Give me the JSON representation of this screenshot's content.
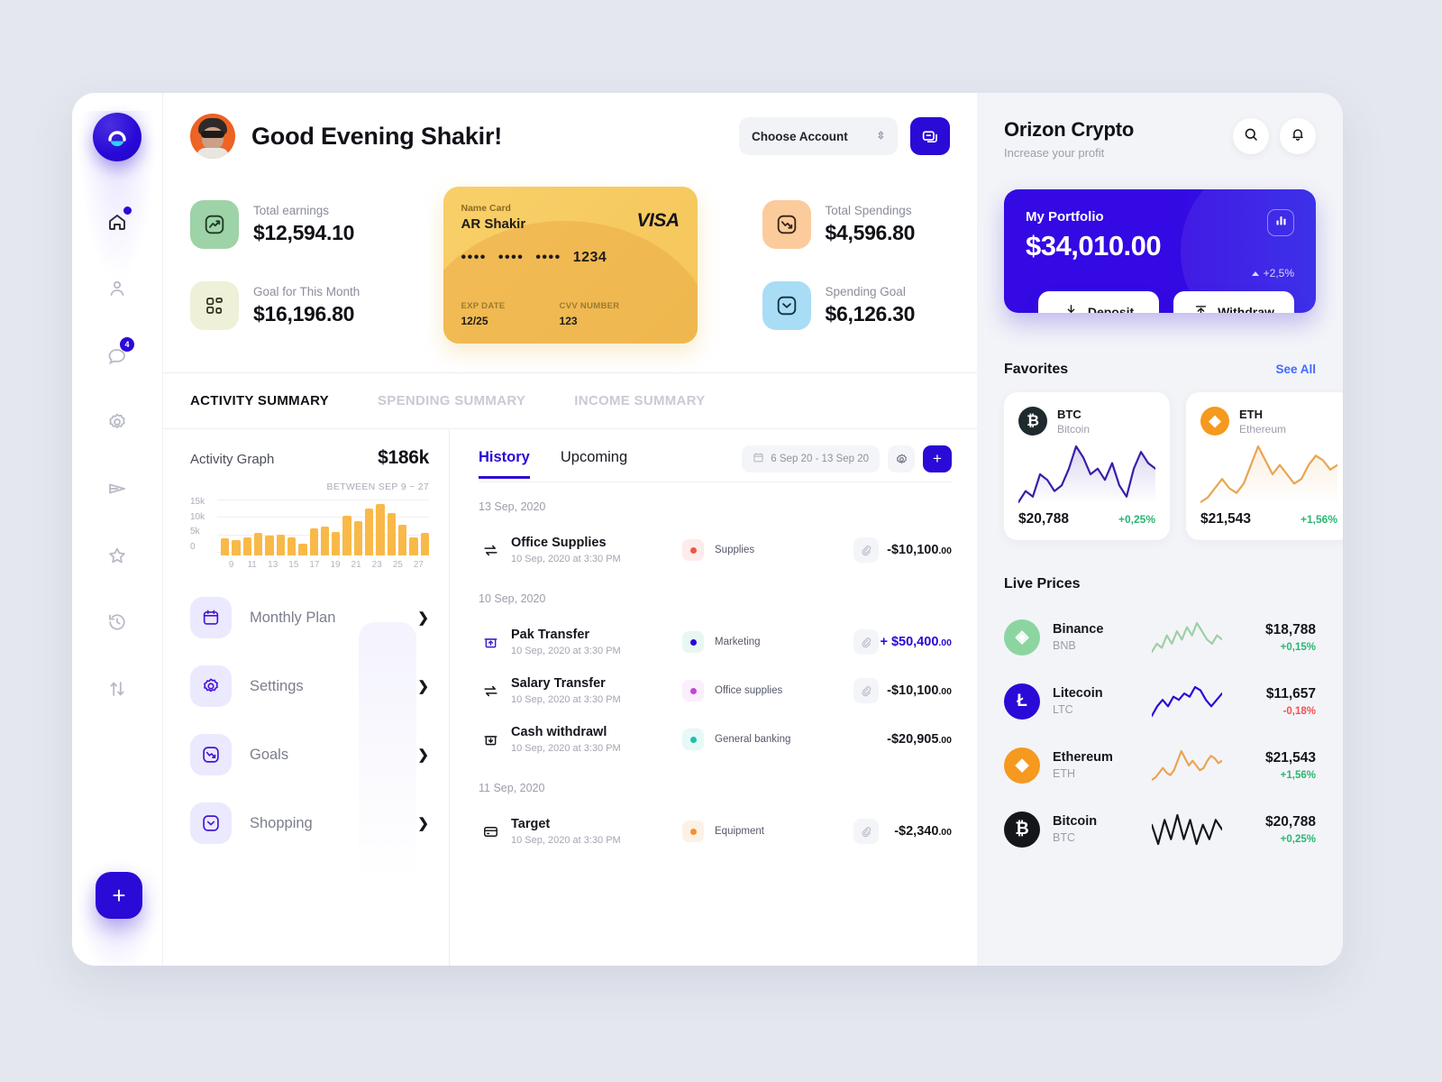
{
  "rail": {
    "logo_name": "orizon-logo",
    "items": [
      {
        "name": "home-icon",
        "badge": "dot"
      },
      {
        "name": "user-icon",
        "badge": ""
      },
      {
        "name": "chat-icon",
        "badge": "4"
      },
      {
        "name": "gear-icon",
        "badge": ""
      },
      {
        "name": "send-icon",
        "badge": ""
      },
      {
        "name": "star-icon",
        "badge": ""
      },
      {
        "name": "history-icon",
        "badge": ""
      },
      {
        "name": "transfer-icon",
        "badge": ""
      }
    ],
    "fab_label": "+"
  },
  "topbar": {
    "greeting": "Good Evening Shakir!",
    "account_select": "Choose Account",
    "message_icon": "message-icon"
  },
  "stats": {
    "left": [
      {
        "label": "Total earnings",
        "value": "$12,594.10",
        "icon": "trend-up-icon",
        "bg": "#9ed3a7",
        "fg": "#1f3a26"
      },
      {
        "label": "Goal for This Month",
        "value": "$16,196.80",
        "icon": "grid-icon",
        "bg": "#eff0d8",
        "fg": "#2d3119"
      }
    ],
    "right": [
      {
        "label": "Total Spendings",
        "value": "$4,596.80",
        "icon": "trend-down-icon",
        "bg": "#fbcb9c",
        "fg": "#3a2415"
      },
      {
        "label": "Spending Goal",
        "value": "$6,126.30",
        "icon": "wallet-icon",
        "bg": "#a9ddf5",
        "fg": "#10303f"
      }
    ]
  },
  "card": {
    "name_label": "Name Card",
    "holder": "AR Shakir",
    "brand": "VISA",
    "mask_groups": [
      "••••",
      "••••",
      "••••"
    ],
    "last4": "1234",
    "exp_label": "EXP DATE",
    "exp_value": "12/25",
    "cvv_label": "CVV NUMBER",
    "cvv_value": "123"
  },
  "summary_tabs": [
    {
      "label": "ACTIVITY SUMMARY",
      "active": true
    },
    {
      "label": "SPENDING SUMMARY",
      "active": false
    },
    {
      "label": "INCOME SUMMARY",
      "active": false
    }
  ],
  "activity": {
    "title": "Activity Graph",
    "amount": "$186k",
    "range_label": "BETWEEN SEP 9 ~ 27"
  },
  "chart_data": {
    "type": "bar",
    "title": "Activity Graph",
    "subtitle": "BETWEEN SEP 9 ~ 27",
    "total": "$186k",
    "xlabel": "",
    "ylabel": "",
    "ylim": [
      0,
      15000
    ],
    "ytick_labels": [
      "15k",
      "10k",
      "5k",
      "0"
    ],
    "yticks": [
      15000,
      10000,
      5000,
      0
    ],
    "grid": true,
    "legend": "none",
    "categories": [
      "9",
      "10",
      "11",
      "12",
      "13",
      "14",
      "15",
      "16",
      "17",
      "18",
      "19",
      "20",
      "21",
      "22",
      "23",
      "24",
      "25",
      "26",
      "27"
    ],
    "xtick_labels": [
      "9",
      "11",
      "13",
      "15",
      "17",
      "19",
      "21",
      "23",
      "25",
      "27"
    ],
    "values": [
      4600,
      4200,
      4800,
      6100,
      5400,
      5600,
      4800,
      3200,
      7200,
      7800,
      6200,
      10700,
      9300,
      12500,
      13900,
      11300,
      8200,
      4900,
      6000
    ],
    "bar_color": "#f9b949"
  },
  "menu": [
    {
      "label": "Monthly Plan",
      "icon": "calendar-icon"
    },
    {
      "label": "Settings",
      "icon": "gear-icon"
    },
    {
      "label": "Goals",
      "icon": "trend-down-icon"
    },
    {
      "label": "Shopping",
      "icon": "wallet-icon"
    }
  ],
  "history": {
    "tabs": [
      {
        "label": "History",
        "active": true
      },
      {
        "label": "Upcoming",
        "active": false
      }
    ],
    "date_range": "6 Sep 20 - 13 Sep 20",
    "calendar_icon": "calendar-icon",
    "gear_icon": "gear-icon",
    "add_label": "+",
    "groups": [
      {
        "date": "13 Sep, 2020",
        "rows": [
          {
            "icon": "transfer-icon",
            "title": "Office Supplies",
            "time": "10 Sep, 2020 at 3:30 PM",
            "category": "Supplies",
            "dot": "#ef5744",
            "dot_bg": "#fdeceb",
            "clip": "clip-icon",
            "amount": "-$10,100",
            "cents": ".00",
            "positive": false
          }
        ]
      },
      {
        "date": "10 Sep, 2020",
        "rows": [
          {
            "icon": "bank-up-icon",
            "title": "Pak Transfer",
            "time": "10 Sep, 2020 at 3:30 PM",
            "category": "Marketing",
            "dot": "#2a0ad6",
            "dot_bg": "#e9f7f1",
            "clip": "clip-icon",
            "amount": "+ $50,400",
            "cents": ".00",
            "positive": true
          },
          {
            "icon": "transfer-icon",
            "title": "Salary Transfer",
            "time": "10 Sep, 2020 at 3:30 PM",
            "category": "Office supplies",
            "dot": "#c642d8",
            "dot_bg": "#fbeefd",
            "clip": "clip-icon",
            "amount": "-$10,100",
            "cents": ".00",
            "positive": false
          },
          {
            "icon": "bank-down-icon",
            "title": "Cash withdrawl",
            "time": "10 Sep, 2020 at 3:30 PM",
            "category": "General banking",
            "dot": "#1fc0ae",
            "dot_bg": "#e6f9f7",
            "clip": "",
            "amount": "-$20,905",
            "cents": ".00",
            "positive": false
          }
        ]
      },
      {
        "date": "11 Sep, 2020",
        "rows": [
          {
            "icon": "card-icon",
            "title": "Target",
            "time": "10 Sep, 2020 at 3:30 PM",
            "category": "Equipment",
            "dot": "#f0922f",
            "dot_bg": "#fdf1e6",
            "clip": "clip-icon",
            "amount": "-$2,340",
            "cents": ".00",
            "positive": false
          }
        ]
      }
    ]
  },
  "aside": {
    "brand": "Orizon Crypto",
    "tagline": "Increase your profit",
    "search_icon": "search-icon",
    "bell_icon": "bell-icon",
    "portfolio": {
      "label": "My Portfolio",
      "amount": "$34,010.00",
      "change": "+2,5%",
      "chart_icon": "bar-chart-icon",
      "deposit_label": "Deposit",
      "deposit_icon": "download-icon",
      "withdraw_label": "Withdraw",
      "withdraw_icon": "upload-icon"
    },
    "favorites": {
      "title": "Favorites",
      "see_all": "See All",
      "cards": [
        {
          "symbol": "BTC",
          "name": "Bitcoin",
          "price": "$20,788",
          "change": "+0,25%",
          "up": true,
          "color": "#1f2a2e",
          "glyph": "₿",
          "line": "#3a1ea8"
        },
        {
          "symbol": "ETH",
          "name": "Ethereum",
          "price": "$21,543",
          "change": "+1,56%",
          "up": true,
          "color": "#f5991f",
          "glyph": "◆",
          "line": "#e8a552"
        }
      ]
    },
    "live_prices": {
      "title": "Live Prices",
      "rows": [
        {
          "name": "Binance",
          "symbol": "BNB",
          "price": "$18,788",
          "change": "+0,15%",
          "up": true,
          "color": "#8cd5a0",
          "glyph": "◈",
          "line": "#9ecfa6"
        },
        {
          "name": "Litecoin",
          "symbol": "LTC",
          "price": "$11,657",
          "change": "-0,18%",
          "up": false,
          "color": "#2a0ad6",
          "glyph": "Ł",
          "line": "#2a0ad6"
        },
        {
          "name": "Ethereum",
          "symbol": "ETH",
          "price": "$21,543",
          "change": "+1,56%",
          "up": true,
          "color": "#f5991f",
          "glyph": "◆",
          "line": "#e8a552"
        },
        {
          "name": "Bitcoin",
          "symbol": "BTC",
          "price": "$20,788",
          "change": "+0,25%",
          "up": true,
          "color": "#15161c",
          "glyph": "₿",
          "line": "#15161c"
        }
      ]
    }
  }
}
